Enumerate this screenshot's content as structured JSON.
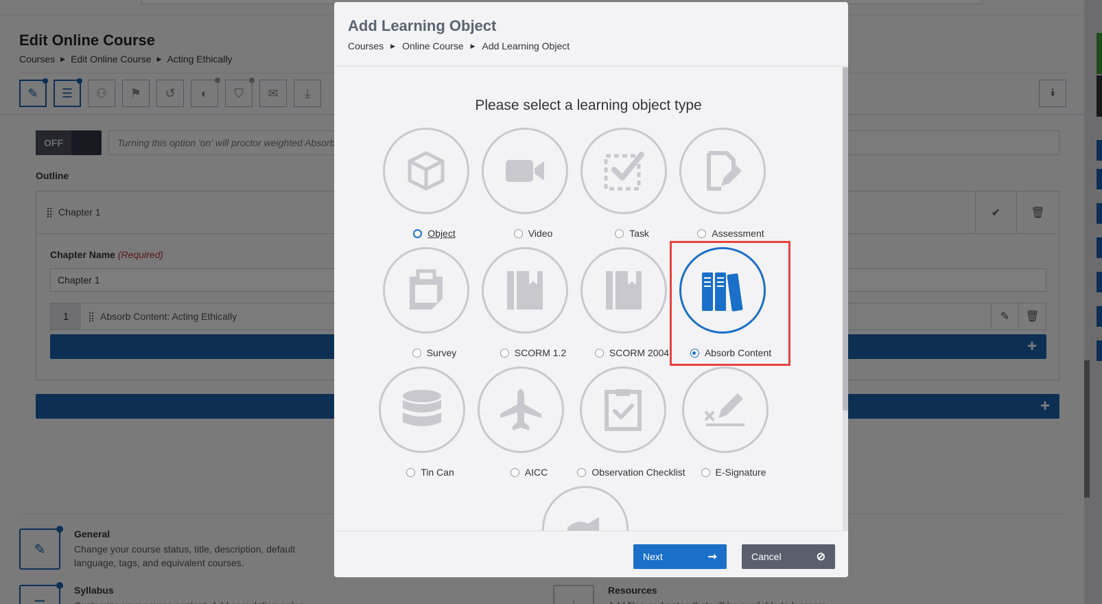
{
  "page": {
    "title": "Edit Online Course",
    "breadcrumbs": [
      "Courses",
      "Edit Online Course",
      "Acting Ethically"
    ],
    "toggle_label": "OFF",
    "proctor_text": "Turning this option 'on' will proctor weighted Absorb",
    "outline_label": "Outline",
    "chapter_header": "Chapter 1",
    "chapter_name_label": "Chapter Name",
    "chapter_name_required": "(Required)",
    "chapter_name_value": "Chapter 1",
    "lesson_number": "1",
    "lesson_text": "Absorb Content:  Acting Ethically",
    "cards": [
      {
        "title": "General",
        "desc": "Change your course status, title, description, default language, tags, and equivalent courses."
      },
      {
        "title": "Syllabus",
        "desc": "Customize your course content. Add completion order,"
      },
      {
        "title": "Resources",
        "desc": "Add files and notes that will be available to learners"
      }
    ]
  },
  "modal": {
    "title": "Add Learning Object",
    "breadcrumbs": [
      "Courses",
      "Online Course",
      "Add Learning Object"
    ],
    "prompt": "Please select a learning object type",
    "selected": "Absorb Content",
    "options": [
      {
        "label": "Object",
        "icon": "cube-icon",
        "state": "focus"
      },
      {
        "label": "Video",
        "icon": "video-camera-icon",
        "state": "none"
      },
      {
        "label": "Task",
        "icon": "task-check-icon",
        "state": "none"
      },
      {
        "label": "Assessment",
        "icon": "assessment-edit-icon",
        "state": "none"
      },
      {
        "label": "Survey",
        "icon": "clipboard-icon",
        "state": "none"
      },
      {
        "label": "SCORM 1.2",
        "icon": "book-bookmark-icon",
        "state": "none"
      },
      {
        "label": "SCORM 2004",
        "icon": "book-bookmark-icon",
        "state": "none"
      },
      {
        "label": "Absorb Content",
        "icon": "books-icon",
        "state": "checked"
      },
      {
        "label": "Tin Can",
        "icon": "database-icon",
        "state": "none"
      },
      {
        "label": "AICC",
        "icon": "airplane-icon",
        "state": "none"
      },
      {
        "label": "Observation Checklist",
        "icon": "checklist-icon",
        "state": "none"
      },
      {
        "label": "E-Signature",
        "icon": "signature-icon",
        "state": "none"
      }
    ],
    "next_label": "Next",
    "cancel_label": "Cancel"
  },
  "colors": {
    "accent": "#1a6fc9",
    "highlight": "#e84040",
    "icon_grey": "#c8c8ce"
  }
}
